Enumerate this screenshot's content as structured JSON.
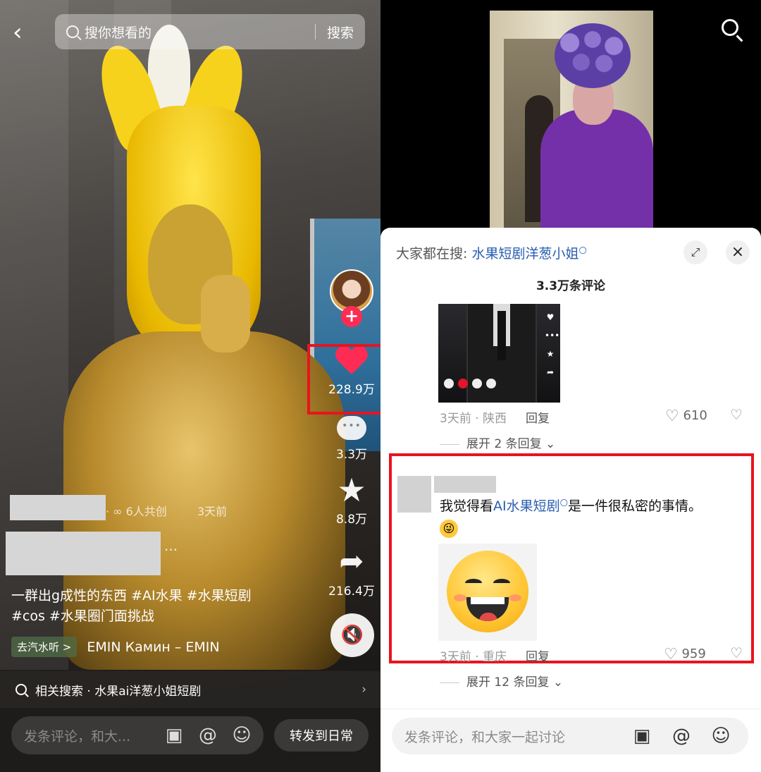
{
  "left": {
    "search": {
      "placeholder": "搜你想看的",
      "button": "搜索"
    },
    "actions": {
      "likes": "228.9万",
      "comments": "3.3万",
      "favorites": "8.8万",
      "shares": "216.4万"
    },
    "cocreate": "6人共创",
    "time": "3天前",
    "more": "...",
    "caption_line1": "一群出g成性的东西 #AI水果 #水果短剧",
    "caption_line2": "#cos #水果圈门面挑战",
    "music_tag": "去汽水听 >",
    "music_song": "EMIN   Камин – EMIN",
    "related": "相关搜索 · 水果ai洋葱小姐短剧",
    "comment_placeholder": "发条评论，和大...",
    "repost": "转发到日常"
  },
  "right": {
    "everyone_prefix": "大家都在搜:",
    "everyone_keyword": "水果短剧洋葱小姐",
    "comment_count": "3.3万条评论",
    "comment1": {
      "meta": "3天前 · 陕西",
      "reply": "回复",
      "likes": "610",
      "expand": "展开 2 条回复"
    },
    "comment2": {
      "text_prefix": "我觉得看",
      "text_keyword": "AI水果短剧",
      "text_suffix": "是一件很私密的事情。",
      "meta": "3天前 · 重庆",
      "reply": "回复",
      "likes": "959",
      "expand": "展开 12 条回复"
    },
    "comment_placeholder": "发条评论，和大家一起讨论"
  },
  "colors": {
    "like_red": "#fe2c55",
    "highlight_red": "#e8141e",
    "keyword_blue": "#2a5db0"
  },
  "icons": [
    "back-arrow-icon",
    "search-icon",
    "heart-icon",
    "comment-icon",
    "star-icon",
    "share-icon",
    "mute-icon",
    "image-icon",
    "at-icon",
    "emoji-icon",
    "close-icon",
    "expand-icon",
    "dislike-icon"
  ]
}
